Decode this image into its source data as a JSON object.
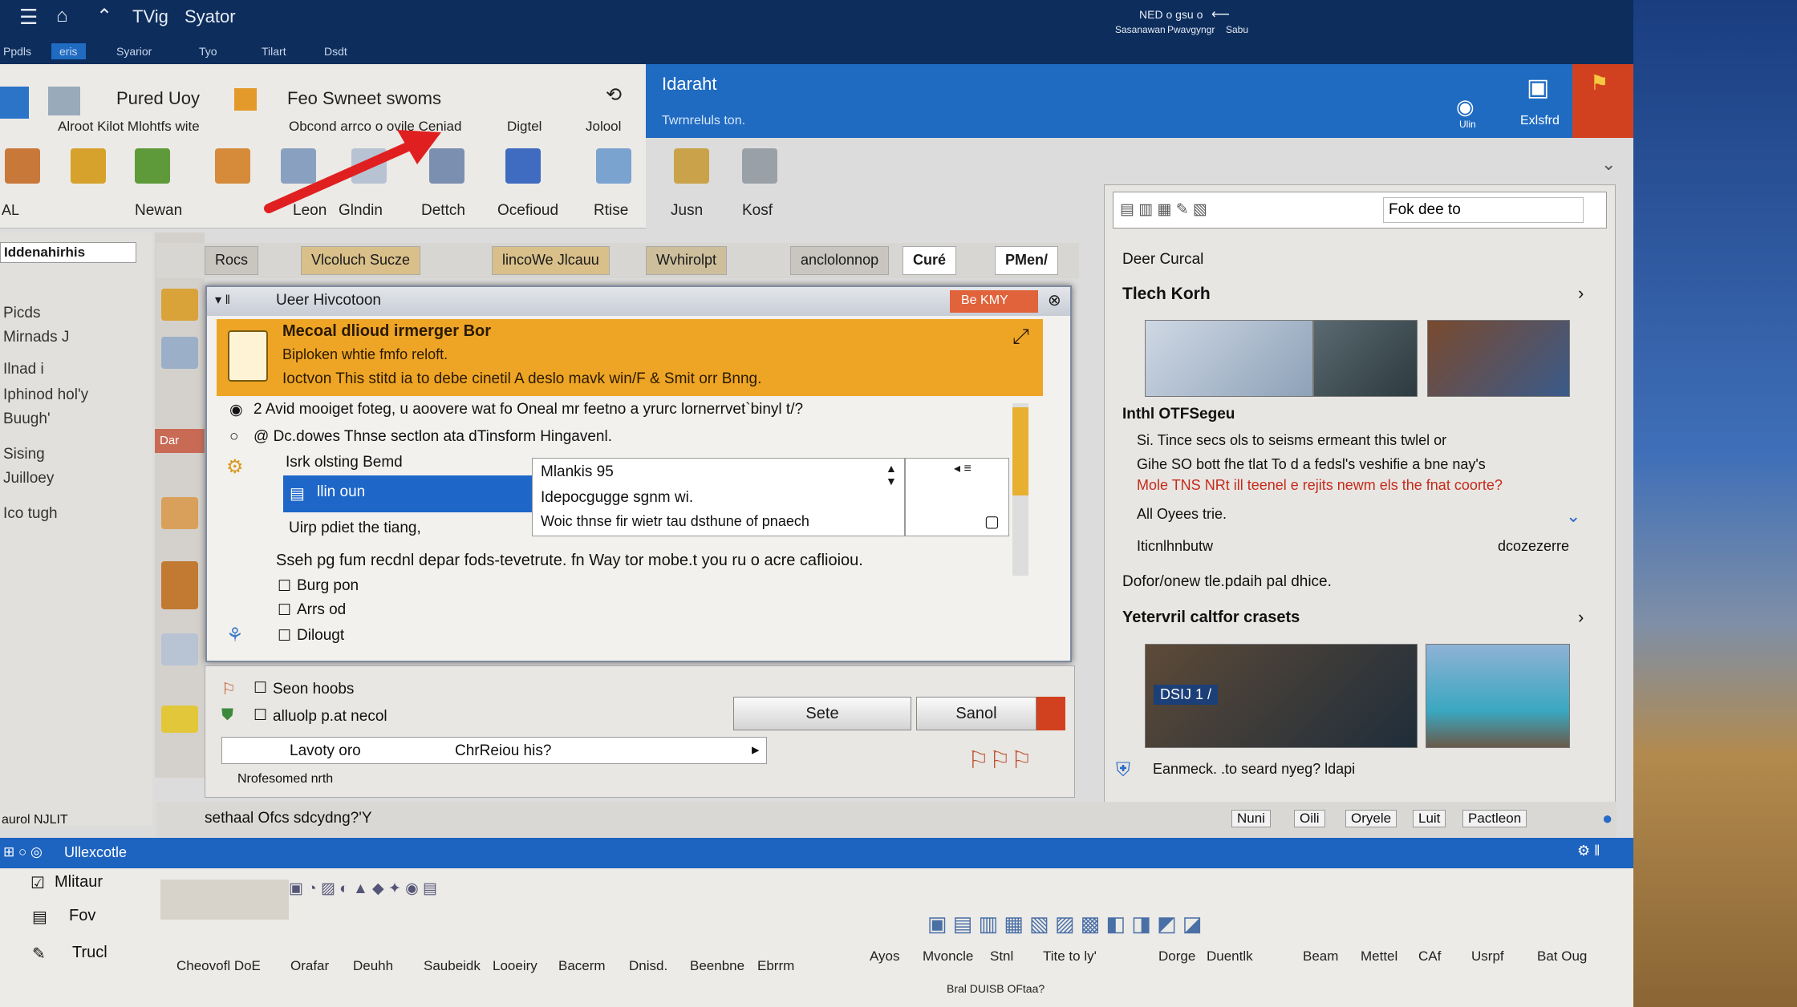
{
  "titlebar": {
    "menu_icon": "hamburger-icon",
    "items": [
      "TVig",
      "Syator"
    ],
    "right_top": "NED o gsu o",
    "right_mid1": "Sasanawan",
    "right_mid2": "Pwavgyngr",
    "right_mid3": "Sabu"
  },
  "tabs": [
    "Ppdls",
    "eris",
    "Syarior",
    "Tyo",
    "Tilart",
    "Dsdt"
  ],
  "ribbon": {
    "group1_top": "Pured Uoy",
    "group1_desc": "Alroot  Kilot Mlohtfs wite",
    "group2_top": "Feo Swneet swoms",
    "group2_desc": "Obcond  arrco o ovile Ceniad",
    "group2_ext1": "Digtel",
    "group2_ext2": "Jolool",
    "buttons": [
      "AL",
      "",
      "Newan",
      "",
      "",
      "Leon",
      "Glndin",
      "Dettch",
      "Ocefioud",
      "Rtise",
      "Jusn",
      "Kosf"
    ]
  },
  "bluepanel": {
    "title": "Idaraht",
    "subtitle": "Twrnreluls ton.",
    "btn1": "Ulin",
    "btn2": "Exlsfrd"
  },
  "leftpane": {
    "header": "Iddenahirhis",
    "items": [
      "Picds",
      "Mirnads J",
      "Ilnad i",
      "Iphinod hol'y",
      "Buugh'",
      "Sising",
      "Juilloey",
      "Ico tugh"
    ]
  },
  "workbar": {
    "tabs": [
      "Rocs",
      "Vlcoluch  Sucze",
      "lincoWe Jlcauu",
      "Wvhirolpt",
      "anclolonnop",
      "Curé",
      "PMen/"
    ]
  },
  "dialog": {
    "title": "Ueer Hivcotoon",
    "title_badge": "Be KMY",
    "banner": {
      "line1": "Mecoal dlioud irmerger Bor",
      "line2": "Biploken whtie fmfo reloft.",
      "line3": "Ioctvon This stitd ia to debe cinetil A deslo mavk win/F & Smit orr Bnng."
    },
    "opt1": "2 Avid mooiget foteg, u aoovere wat fo Oneal mr feetno a yrurc lornerrvet`binyl t/?",
    "opt2": "@ Dc.dowes Thnse sectlon ata dTinsform Hingavenl.",
    "list_header": "Isrk olsting Bemd",
    "selected": "llin oun",
    "below_sel": "Uirp pdiet the tiang,",
    "list_items": [
      "Mlankis 95",
      "Idepocgugge sgnm wi.",
      "Woic thnse fir wietr tau dsthune of pnaech"
    ],
    "info": "Sseh pg fum recdnl depar fods-tevetrute. fn Way tor mobe.t you ru o acre caflioiou.",
    "checks": [
      "Burg pon",
      "Arrs od",
      "Dilougt"
    ]
  },
  "lower": {
    "row1": "Seon hoobs",
    "row2": "alluolp p.at necol",
    "combo1": "Lavoty oro",
    "combo2": "ChrReiou his?",
    "row4": "Nrofesomed nrth",
    "save": "Sete",
    "send": "Sanol"
  },
  "rightpanel": {
    "search": "Fok dee to",
    "header": "Deer Curcal",
    "section1": "Tlech Korh",
    "sub1": "Inthl OTFSegeu",
    "item1": "Si. Tince secs ols to seisms ermeant this twlel or",
    "item2": "Gihe SO bott fhe tlat To d a fedsl's veshifie a bne nay's",
    "item2_red": "Mole TNS NRt ill teenel e rejits newm els the fnat coorte?",
    "item3": "All Oyees trie.",
    "item4": "Iticnlhnbutw",
    "item4_right": "dcozezerre",
    "line5": "Dofor/onew tle.pdaih  pal dhice.",
    "section2": "Yetervril caltfor crasets",
    "badge": "DSIJ 1 /",
    "footer": "Eanmeck.  .to seard nyeg?  ldapi"
  },
  "statusbar": {
    "text": "sethaal Ofcs sdcydng?'Y",
    "left_label": "aurol NJLIT",
    "tabs": [
      "Nuni",
      "Oili",
      "Oryele",
      "Luit",
      "Pactleon"
    ]
  },
  "taskbar": {
    "label": "Ullexcotle"
  },
  "bottomribbon": {
    "left_items": [
      "Mlitaur",
      "Fov",
      "Trucl"
    ],
    "labels": [
      "Cheovofl DoE",
      "Orafar",
      "Deuhh",
      "Saubeidk",
      "Looeiry",
      "Bacerm",
      "Dnisd.",
      "Beenbne",
      "Ebrrm",
      "Ayos",
      "Mvoncle",
      "Stnl",
      "Tite to ly'",
      "Dorge",
      "Duentlk",
      "Beam",
      "Mettel",
      "CAf",
      "Usrpf",
      "Bat Oug"
    ],
    "footer": "Bral DUISB OFtaa?"
  },
  "colors": {
    "titlebar": "#0d2d5c",
    "accent": "#1f6bc2",
    "banner": "#eea525",
    "alert": "#d2411f"
  }
}
